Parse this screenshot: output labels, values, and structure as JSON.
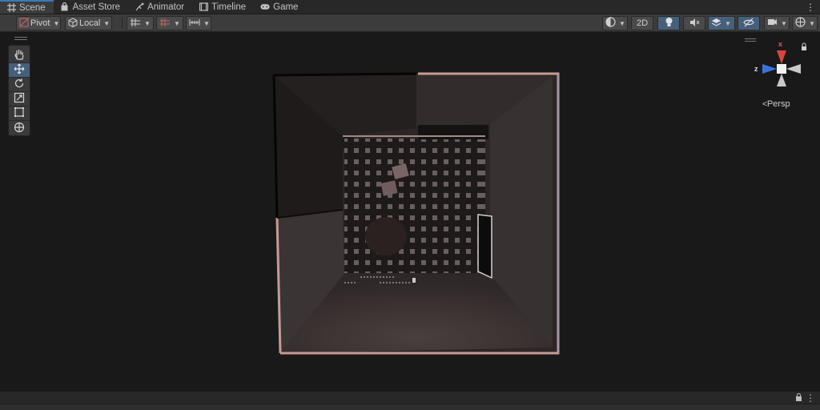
{
  "tabs": [
    {
      "label": "Scene",
      "icon": "scene-grid-icon",
      "active": true
    },
    {
      "label": "Asset Store",
      "icon": "bag-icon",
      "active": false
    },
    {
      "label": "Animator",
      "icon": "animator-icon",
      "active": false
    },
    {
      "label": "Timeline",
      "icon": "film-icon",
      "active": false
    },
    {
      "label": "Game",
      "icon": "gamepad-icon",
      "active": false
    }
  ],
  "toolbar": {
    "pivot_label": "Pivot",
    "local_label": "Local",
    "mode_2d_label": "2D"
  },
  "gizmo": {
    "x_label": "x",
    "z_label": "z",
    "projection_label": "Persp",
    "x_color": "#d9463d",
    "z_color": "#3a74d9"
  },
  "tools": [
    {
      "name": "hand-tool",
      "icon": "hand-icon",
      "active": false
    },
    {
      "name": "move-tool",
      "icon": "move-arrows-icon",
      "active": true
    },
    {
      "name": "rotate-tool",
      "icon": "rotate-icon",
      "active": false
    },
    {
      "name": "scale-tool",
      "icon": "scale-icon",
      "active": false
    },
    {
      "name": "rect-tool",
      "icon": "rect-transform-icon",
      "active": false
    },
    {
      "name": "transform-tool",
      "icon": "transform-icon",
      "active": false
    }
  ],
  "colors": {
    "accent": "#3a79bb",
    "active_button": "#46607c",
    "viewport_bg": "#1a1919"
  }
}
